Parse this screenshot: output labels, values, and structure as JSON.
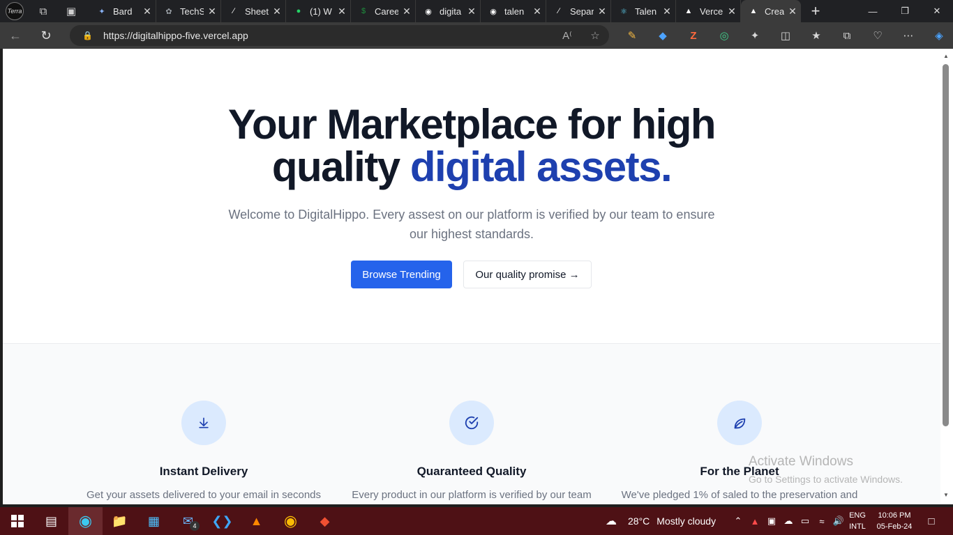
{
  "browser": {
    "tabs": [
      {
        "title": "Bard",
        "icon": "bard-icon",
        "color": "#8ab4f8"
      },
      {
        "title": "TechS",
        "icon": "chatgpt-icon",
        "color": "#9aa0a6"
      },
      {
        "title": "Sheet",
        "icon": "vercel-slash-icon",
        "color": "#ffffff"
      },
      {
        "title": "(1) W",
        "icon": "whatsapp-icon",
        "color": "#25d366"
      },
      {
        "title": "Caree",
        "icon": "dollar-icon",
        "color": "#1e8e3e"
      },
      {
        "title": "digita",
        "icon": "github-icon",
        "color": "#ffffff"
      },
      {
        "title": "talen",
        "icon": "github-icon",
        "color": "#ffffff"
      },
      {
        "title": "Separ",
        "icon": "vercel-slash-icon",
        "color": "#ffffff"
      },
      {
        "title": "Talen",
        "icon": "react-icon",
        "color": "#61dafb"
      },
      {
        "title": "Verce",
        "icon": "vercel-triangle-icon",
        "color": "#ffffff"
      },
      {
        "title": "Creat",
        "icon": "vercel-triangle-icon",
        "color": "#ffffff",
        "active": true
      }
    ],
    "url": "https://digitalhippo-five.vercel.app"
  },
  "hero": {
    "title_line1": "Your Marketplace for high",
    "title_line2_plain": "quality",
    "title_line2_accent": "digital assets.",
    "subtitle": "Welcome to DigitalHippo. Every assest on our platform is verified by our team to ensure our highest standards.",
    "primary_button": "Browse Trending",
    "secondary_button": "Our quality promise →"
  },
  "perks": [
    {
      "title": "Instant Delivery",
      "description": "Get your assets delivered to your email in seconds",
      "icon": "download-icon"
    },
    {
      "title": "Quaranteed Quality",
      "description": "Every product in our platform is verified by our team",
      "icon": "check-circle-icon"
    },
    {
      "title": "For the Planet",
      "description": "We've pledged 1% of saled to the preservation and",
      "icon": "leaf-icon"
    }
  ],
  "watermark": {
    "line1": "Activate Windows",
    "line2": "Go to Settings to activate Windows."
  },
  "taskbar": {
    "weather_temp": "28°C",
    "weather_desc": "Mostly cloudy",
    "mail_badge": "4",
    "lang_line1": "ENG",
    "lang_line2": "INTL",
    "time": "10:06 PM",
    "date": "05-Feb-24"
  },
  "colors": {
    "accent": "#1e40af",
    "primary_button": "#2563eb",
    "taskbar": "#4e1115"
  }
}
